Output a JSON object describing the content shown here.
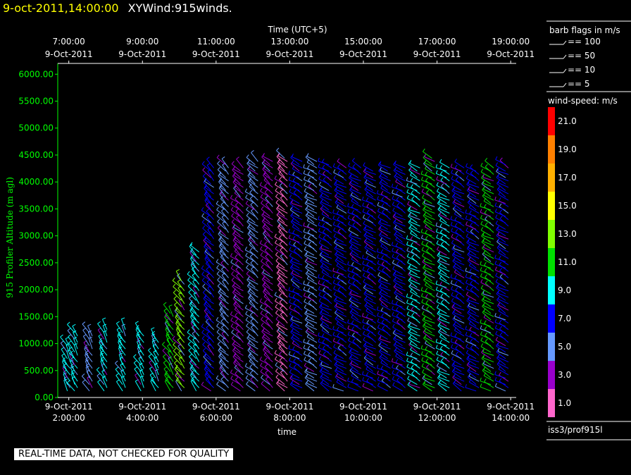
{
  "header": {
    "timestamp": "9-oct-2011,14:00:00",
    "title": "XYWind:915winds."
  },
  "footer": {
    "notice": "REAL-TIME DATA, NOT CHECKED FOR QUALITY"
  },
  "legend": {
    "barb_title": "barb flags in m/s",
    "barbs": [
      "== 100",
      "== 50",
      "== 10",
      "== 5"
    ],
    "speed_title": "wind-speed: m/s",
    "speed_bins": [
      {
        "label": "21.0",
        "color": "#ff0000"
      },
      {
        "label": "19.0",
        "color": "#ff8000"
      },
      {
        "label": "17.0",
        "color": "#ffb000"
      },
      {
        "label": "15.0",
        "color": "#ffff00"
      },
      {
        "label": "13.0",
        "color": "#80ff00"
      },
      {
        "label": "11.0",
        "color": "#00e000"
      },
      {
        "label": "9.0",
        "color": "#00ffff"
      },
      {
        "label": "7.0",
        "color": "#0000ff"
      },
      {
        "label": "5.0",
        "color": "#6699ff"
      },
      {
        "label": "3.0",
        "color": "#9900cc"
      },
      {
        "label": "1.0",
        "color": "#ff66cc"
      }
    ],
    "source": "iss3/prof915l"
  },
  "chart_data": {
    "type": "scatter",
    "ylabel": "915 Profiler Altitude (m agl)",
    "ylabel_color": "#00ff00",
    "xlabel": "time",
    "x2label": "Time (UTC+5)",
    "ylim": [
      0,
      6200
    ],
    "yticks": [
      "0.00",
      "500.00",
      "1000.00",
      "1500.00",
      "2000.00",
      "2500.00",
      "3000.00",
      "3500.00",
      "4000.00",
      "4500.00",
      "5000.00",
      "5500.00",
      "6000.00"
    ],
    "xlim_hours": [
      1.7,
      14.15
    ],
    "xticks": [
      {
        "h": 2,
        "line1": "9-Oct-2011",
        "line2": "2:00:00"
      },
      {
        "h": 4,
        "line1": "9-Oct-2011",
        "line2": "4:00:00"
      },
      {
        "h": 6,
        "line1": "9-Oct-2011",
        "line2": "6:00:00"
      },
      {
        "h": 8,
        "line1": "9-Oct-2011",
        "line2": "8:00:00"
      },
      {
        "h": 10,
        "line1": "9-Oct-2011",
        "line2": "10:00:00"
      },
      {
        "h": 12,
        "line1": "9-Oct-2011",
        "line2": "12:00:00"
      },
      {
        "h": 14,
        "line1": "9-Oct-2011",
        "line2": "14:00:00"
      }
    ],
    "x2ticks": [
      {
        "h": 2,
        "line1": "7:00:00",
        "line2": "9-Oct-2011"
      },
      {
        "h": 4,
        "line1": "9:00:00",
        "line2": "9-Oct-2011"
      },
      {
        "h": 6,
        "line1": "11:00:00",
        "line2": "9-Oct-2011"
      },
      {
        "h": 8,
        "line1": "13:00:00",
        "line2": "9-Oct-2011"
      },
      {
        "h": 10,
        "line1": "15:00:00",
        "line2": "9-Oct-2011"
      },
      {
        "h": 12,
        "line1": "17:00:00",
        "line2": "9-Oct-2011"
      },
      {
        "h": 14,
        "line1": "19:00:00",
        "line2": "9-Oct-2011"
      }
    ],
    "profiles": [
      {
        "h": 2.0,
        "top": 1000,
        "color": "#00ffff",
        "dir": 330
      },
      {
        "h": 2.2,
        "top": 1200,
        "color": "#00ffff",
        "dir": 330
      },
      {
        "h": 2.6,
        "top": 1250,
        "color": "#6699ff",
        "dir": 330
      },
      {
        "h": 3.0,
        "top": 1300,
        "color": "#00ffff",
        "dir": 330
      },
      {
        "h": 3.5,
        "top": 1300,
        "color": "#00ffff",
        "dir": 330
      },
      {
        "h": 4.0,
        "top": 1200,
        "color": "#00ffff",
        "dir": 330
      },
      {
        "h": 4.4,
        "top": 1100,
        "color": "#00ffff",
        "dir": 330
      },
      {
        "h": 4.8,
        "top": 1600,
        "color": "#00e000",
        "dir": 325
      },
      {
        "h": 5.1,
        "top": 2200,
        "color": "#80ff00",
        "dir": 320
      },
      {
        "h": 5.5,
        "top": 2700,
        "color": "#00ffff",
        "dir": 320
      },
      {
        "h": 5.9,
        "top": 4300,
        "color": "#0000ff",
        "dir": 315
      },
      {
        "h": 6.3,
        "top": 4350,
        "color": "#6699ff",
        "dir": 315
      },
      {
        "h": 6.7,
        "top": 4300,
        "color": "#9900cc",
        "dir": 310
      },
      {
        "h": 7.1,
        "top": 4400,
        "color": "#6699ff",
        "dir": 310
      },
      {
        "h": 7.5,
        "top": 4400,
        "color": "#9900cc",
        "dir": 310
      },
      {
        "h": 7.9,
        "top": 4450,
        "color": "#ff66cc",
        "dir": 310
      },
      {
        "h": 8.3,
        "top": 4400,
        "color": "#0000ff",
        "dir": 300
      },
      {
        "h": 8.7,
        "top": 4400,
        "color": "#6699ff",
        "dir": 300
      },
      {
        "h": 9.1,
        "top": 4350,
        "color": "#0000ff",
        "dir": 300
      },
      {
        "h": 9.5,
        "top": 4300,
        "color": "#0000ff",
        "dir": 300
      },
      {
        "h": 9.9,
        "top": 4300,
        "color": "#0000ff",
        "dir": 300
      },
      {
        "h": 10.3,
        "top": 4200,
        "color": "#0000ff",
        "dir": 300
      },
      {
        "h": 10.7,
        "top": 4300,
        "color": "#0000ff",
        "dir": 300
      },
      {
        "h": 11.1,
        "top": 4300,
        "color": "#0000ff",
        "dir": 300
      },
      {
        "h": 11.5,
        "top": 4300,
        "color": "#00ffff",
        "dir": 300
      },
      {
        "h": 11.9,
        "top": 4450,
        "color": "#00e000",
        "dir": 300
      },
      {
        "h": 12.3,
        "top": 4300,
        "color": "#00ffff",
        "dir": 300
      },
      {
        "h": 12.7,
        "top": 4300,
        "color": "#0000ff",
        "dir": 300
      },
      {
        "h": 13.1,
        "top": 4250,
        "color": "#0000ff",
        "dir": 300
      },
      {
        "h": 13.5,
        "top": 4300,
        "color": "#00e000",
        "dir": 300
      },
      {
        "h": 13.9,
        "top": 4350,
        "color": "#0000ff",
        "dir": 300
      }
    ]
  }
}
